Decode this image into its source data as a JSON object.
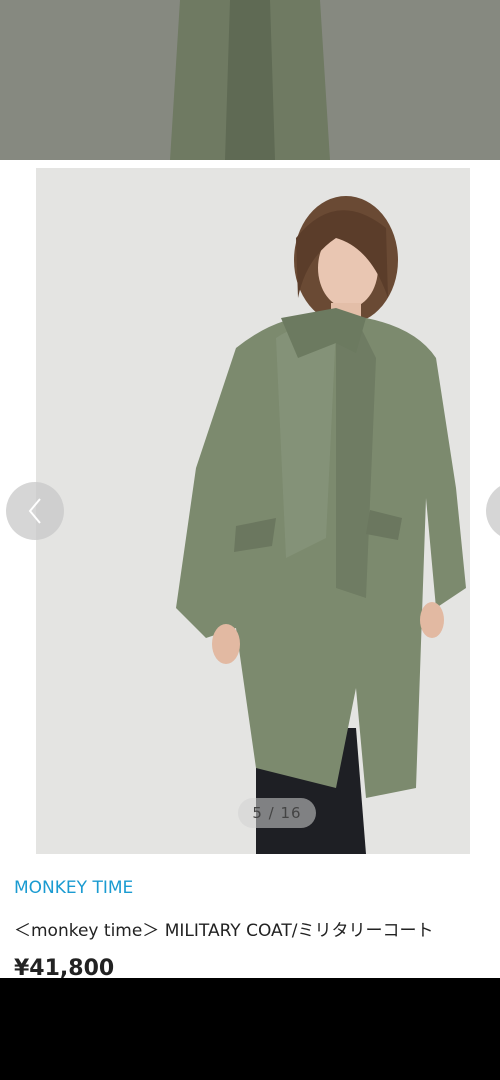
{
  "gallery": {
    "counter": "5 / 16",
    "prev_icon": "chevron-left-icon",
    "next_icon": "chevron-right-icon"
  },
  "product": {
    "brand": "MONKEY TIME",
    "title": "＜monkey time＞ MILITARY COAT/ミリタリーコート",
    "price": "¥41,800"
  },
  "colors": {
    "brand_link": "#1a9bd1",
    "coat": "#7c8a6e",
    "background": "#000000"
  }
}
